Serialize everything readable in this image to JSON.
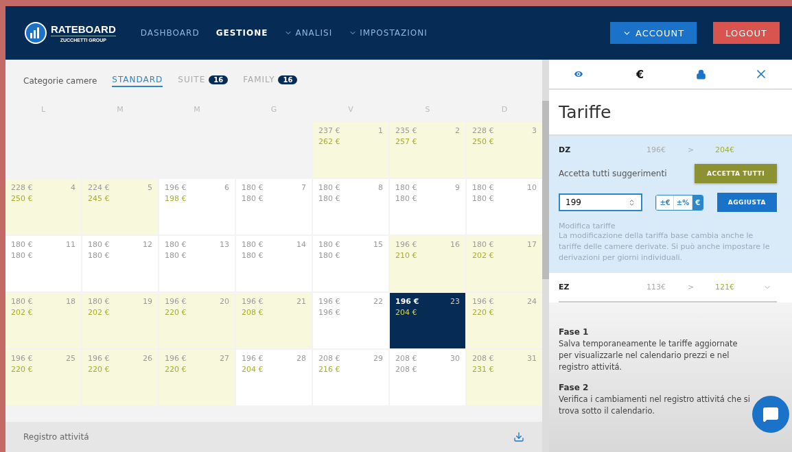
{
  "header": {
    "brand": "RATEBOARD",
    "brand_sub": "ZUCCHETTI GROUP",
    "nav": [
      {
        "label": "DASHBOARD",
        "selected": false,
        "dropdown": false
      },
      {
        "label": "GESTIONE",
        "selected": true,
        "dropdown": false
      },
      {
        "label": "ANALISI",
        "selected": false,
        "dropdown": true
      },
      {
        "label": "IMPOSTAZIONI",
        "selected": false,
        "dropdown": true
      }
    ],
    "account": "ACCOUNT",
    "logout": "LOGOUT"
  },
  "categories": {
    "label": "Categorie camere",
    "items": [
      {
        "label": "STANDARD",
        "selected": true
      },
      {
        "label": "SUITE",
        "selected": false,
        "count": "16"
      },
      {
        "label": "FAMILY",
        "selected": false,
        "count": "16"
      }
    ]
  },
  "calendar": {
    "weekdays": [
      "L",
      "M",
      "M",
      "G",
      "V",
      "S",
      "D"
    ],
    "days": [
      {
        "kind": "empty"
      },
      {
        "kind": "empty"
      },
      {
        "kind": "empty"
      },
      {
        "kind": "empty"
      },
      {
        "kind": "day",
        "day": "1",
        "base": "237 €",
        "suggested": "262 €",
        "changed": true,
        "highlighted": true,
        "selected": false
      },
      {
        "kind": "day",
        "day": "2",
        "base": "235 €",
        "suggested": "257 €",
        "changed": true,
        "highlighted": true,
        "selected": false
      },
      {
        "kind": "day",
        "day": "3",
        "base": "228 €",
        "suggested": "250 €",
        "changed": true,
        "highlighted": true,
        "selected": false
      },
      {
        "kind": "day",
        "day": "4",
        "base": "228 €",
        "suggested": "250 €",
        "changed": true,
        "highlighted": true,
        "selected": false
      },
      {
        "kind": "day",
        "day": "5",
        "base": "224 €",
        "suggested": "245 €",
        "changed": true,
        "highlighted": true,
        "selected": false
      },
      {
        "kind": "day",
        "day": "6",
        "base": "196 €",
        "suggested": "198 €",
        "changed": true,
        "highlighted": false,
        "selected": false
      },
      {
        "kind": "day",
        "day": "7",
        "base": "180 €",
        "suggested": "180 €",
        "changed": false,
        "highlighted": false,
        "selected": false
      },
      {
        "kind": "day",
        "day": "8",
        "base": "180 €",
        "suggested": "180 €",
        "changed": false,
        "highlighted": false,
        "selected": false
      },
      {
        "kind": "day",
        "day": "9",
        "base": "180 €",
        "suggested": "180 €",
        "changed": false,
        "highlighted": false,
        "selected": false
      },
      {
        "kind": "day",
        "day": "10",
        "base": "180 €",
        "suggested": "180 €",
        "changed": false,
        "highlighted": false,
        "selected": false
      },
      {
        "kind": "day",
        "day": "11",
        "base": "180 €",
        "suggested": "180 €",
        "changed": false,
        "highlighted": false,
        "selected": false
      },
      {
        "kind": "day",
        "day": "12",
        "base": "180 €",
        "suggested": "180 €",
        "changed": false,
        "highlighted": false,
        "selected": false
      },
      {
        "kind": "day",
        "day": "13",
        "base": "180 €",
        "suggested": "180 €",
        "changed": false,
        "highlighted": false,
        "selected": false
      },
      {
        "kind": "day",
        "day": "14",
        "base": "180 €",
        "suggested": "180 €",
        "changed": false,
        "highlighted": false,
        "selected": false
      },
      {
        "kind": "day",
        "day": "15",
        "base": "180 €",
        "suggested": "180 €",
        "changed": false,
        "highlighted": false,
        "selected": false
      },
      {
        "kind": "day",
        "day": "16",
        "base": "196 €",
        "suggested": "210 €",
        "changed": true,
        "highlighted": true,
        "selected": false
      },
      {
        "kind": "day",
        "day": "17",
        "base": "180 €",
        "suggested": "202 €",
        "changed": true,
        "highlighted": true,
        "selected": false
      },
      {
        "kind": "day",
        "day": "18",
        "base": "180 €",
        "suggested": "202 €",
        "changed": true,
        "highlighted": true,
        "selected": false
      },
      {
        "kind": "day",
        "day": "19",
        "base": "180 €",
        "suggested": "202 €",
        "changed": true,
        "highlighted": true,
        "selected": false
      },
      {
        "kind": "day",
        "day": "20",
        "base": "196 €",
        "suggested": "220 €",
        "changed": true,
        "highlighted": true,
        "selected": false
      },
      {
        "kind": "day",
        "day": "21",
        "base": "196 €",
        "suggested": "208 €",
        "changed": true,
        "highlighted": true,
        "selected": false
      },
      {
        "kind": "day",
        "day": "22",
        "base": "196 €",
        "suggested": "196 €",
        "changed": false,
        "highlighted": false,
        "selected": false
      },
      {
        "kind": "day",
        "day": "23",
        "base": "196 €",
        "suggested": "204 €",
        "changed": true,
        "highlighted": false,
        "selected": true
      },
      {
        "kind": "day",
        "day": "24",
        "base": "196 €",
        "suggested": "220 €",
        "changed": true,
        "highlighted": true,
        "selected": false
      },
      {
        "kind": "day",
        "day": "25",
        "base": "196 €",
        "suggested": "220 €",
        "changed": true,
        "highlighted": true,
        "selected": false
      },
      {
        "kind": "day",
        "day": "26",
        "base": "196 €",
        "suggested": "220 €",
        "changed": true,
        "highlighted": true,
        "selected": false
      },
      {
        "kind": "day",
        "day": "27",
        "base": "196 €",
        "suggested": "220 €",
        "changed": true,
        "highlighted": true,
        "selected": false
      },
      {
        "kind": "day",
        "day": "28",
        "base": "196 €",
        "suggested": "204 €",
        "changed": true,
        "highlighted": false,
        "selected": false
      },
      {
        "kind": "day",
        "day": "29",
        "base": "208 €",
        "suggested": "216 €",
        "changed": true,
        "highlighted": false,
        "selected": false
      },
      {
        "kind": "day",
        "day": "30",
        "base": "208 €",
        "suggested": "208 €",
        "changed": false,
        "highlighted": false,
        "selected": false
      },
      {
        "kind": "day",
        "day": "31",
        "base": "208 €",
        "suggested": "231 €",
        "changed": true,
        "highlighted": true,
        "selected": false
      }
    ]
  },
  "activity_log": {
    "title": "Registro attivitá"
  },
  "side_panel": {
    "tabs": [
      {
        "kind": "eye"
      },
      {
        "kind": "text",
        "label": "€"
      },
      {
        "kind": "lock"
      },
      {
        "kind": "close"
      }
    ],
    "title": "Tariffe",
    "rooms": [
      {
        "code": "DZ",
        "from": "196€",
        "arrow": ">",
        "to": "204€",
        "expanded": true,
        "accept_label": "Accetta tutti suggerimenti",
        "accept_button": "ACCETTA TUTTI",
        "amount": "199",
        "modes": [
          {
            "label": "±€",
            "selected": false
          },
          {
            "label": "±%",
            "selected": false
          },
          {
            "label": "€",
            "selected": true
          }
        ],
        "adjust_button": "AGGIUSTA",
        "note_title": "Modifica tariffe",
        "note": "La modificazione della tariffa base cambia anche le tariffe delle camere derivate. Si può anche impostare le derivazioni per giorni individuali."
      },
      {
        "code": "EZ",
        "from": "113€",
        "arrow": ">",
        "to": "121€",
        "expanded": false
      }
    ],
    "steps": [
      {
        "title": "Fase 1",
        "text": "Salva temporaneamente le tariffe aggiornate per visualizzarle nel calendario prezzi e nel registro attivitá."
      },
      {
        "title": "Fase 2",
        "text": "Verifica i cambiamenti nel registro attivitá che si trova sotto il calendario."
      }
    ]
  }
}
